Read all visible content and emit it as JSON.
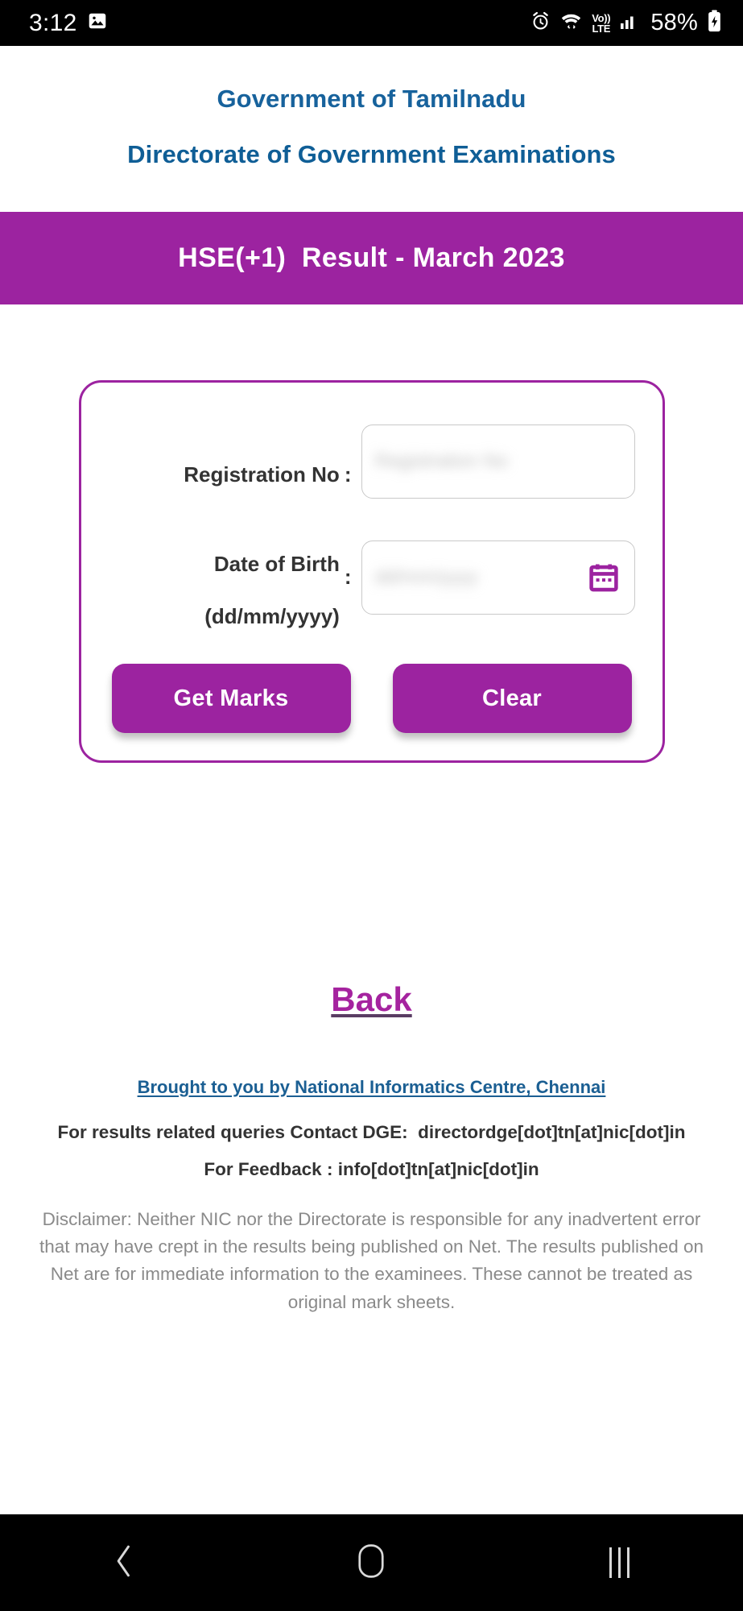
{
  "status_bar": {
    "time": "3:12",
    "battery_percent": "58%",
    "icons": {
      "photo": "image-icon",
      "alarm": "alarm-icon",
      "wifi": "wifi-icon",
      "volte_top": "Vo))",
      "volte_bottom": "LTE",
      "signal": "signal-bars-icon",
      "battery": "battery-charging-icon"
    }
  },
  "header": {
    "gov_title": "Government of Tamilnadu",
    "dept_title": "Directorate of Government Examinations",
    "banner_title": "HSE(+1)  Result - March 2023",
    "banner_color": "#9c23a0",
    "title_color": "#17629c"
  },
  "form": {
    "registration": {
      "label": "Registration No",
      "colon": ":",
      "value": "",
      "placeholder": "Registration No"
    },
    "dob": {
      "label_line1": "Date of Birth",
      "label_line2": "(dd/mm/yyyy)",
      "colon": ":",
      "value": "",
      "placeholder": "dd/mm/yyyy",
      "calendar_icon": "calendar-icon"
    },
    "buttons": {
      "submit": "Get Marks",
      "clear": "Clear"
    },
    "accent_color": "#9c23a0"
  },
  "back_link": {
    "label": "Back",
    "color": "#a5239f"
  },
  "footer": {
    "nic_link": "Brought to you by National Informatics Centre, Chennai",
    "contact_line": "For results related queries Contact DGE:  directordge[dot]tn[at]nic[dot]in",
    "feedback_line": "For Feedback : info[dot]tn[at]nic[dot]in",
    "disclaimer": "Disclaimer: Neither NIC nor the Directorate is responsible for any inadvertent error that may have crept in the results being published on Net. The results published on Net are for immediate information to the examinees. These cannot be treated as original mark sheets.",
    "link_color": "#1b5f93"
  },
  "nav_bar": {
    "back": "back-chevron-icon",
    "home": "home-icon",
    "recents": "recents-icon"
  }
}
